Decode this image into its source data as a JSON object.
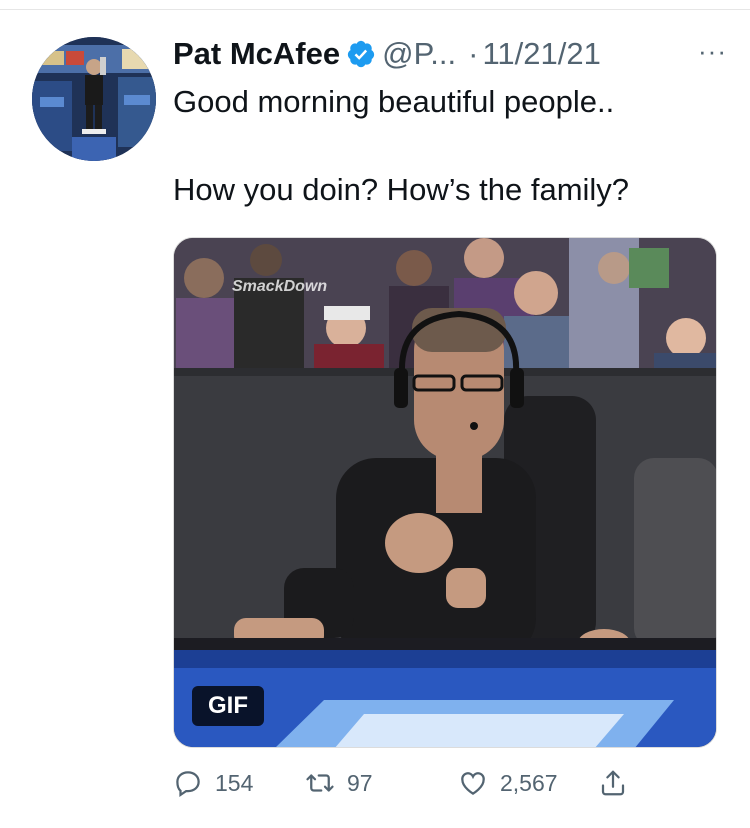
{
  "tweet": {
    "author_name": "Pat McAfee",
    "handle": "@P...",
    "separator": "·",
    "date": "11/21/21",
    "more_label": "···",
    "text_line1": "Good morning beautiful people..",
    "text_line2": "How you doin? How’s the family?",
    "media": {
      "badge": "GIF",
      "overlay_text": "SmackDown"
    },
    "stats": {
      "replies": "154",
      "retweets": "97",
      "likes": "2,567"
    }
  },
  "colors": {
    "verified_blue": "#1d9bf0",
    "secondary_text": "#536471",
    "primary_text": "#0f1419"
  },
  "icons": [
    "verified-badge-icon",
    "more-icon",
    "reply-icon",
    "retweet-icon",
    "like-icon",
    "share-icon"
  ]
}
